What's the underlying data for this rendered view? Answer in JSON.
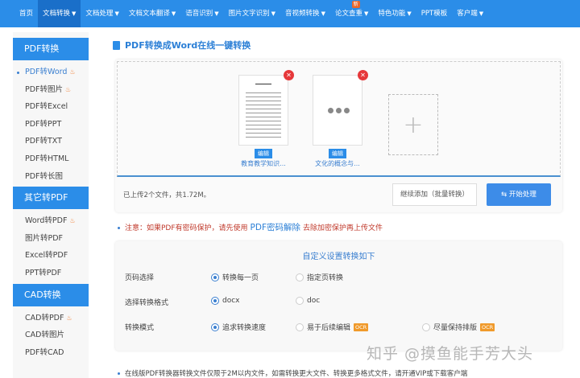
{
  "nav": [
    {
      "label": "首页",
      "caret": false
    },
    {
      "label": "文档转换",
      "caret": true,
      "active": true
    },
    {
      "label": "文档处理",
      "caret": true
    },
    {
      "label": "文档文本翻译",
      "caret": true
    },
    {
      "label": "语音识别",
      "caret": true
    },
    {
      "label": "图片文字识别",
      "caret": true
    },
    {
      "label": "音视频转换",
      "caret": true
    },
    {
      "label": "论文查重",
      "caret": true,
      "badge": "新"
    },
    {
      "label": "特色功能",
      "caret": true
    },
    {
      "label": "PPT模板",
      "caret": false
    },
    {
      "label": "客户端",
      "caret": true
    }
  ],
  "sidebar": [
    {
      "header": "PDF转换",
      "items": [
        {
          "label": "PDF转Word",
          "hot": true,
          "active": true
        },
        {
          "label": "PDF转图片",
          "hot": true
        },
        {
          "label": "PDF转Excel"
        },
        {
          "label": "PDF转PPT"
        },
        {
          "label": "PDF转TXT"
        },
        {
          "label": "PDF转HTML"
        },
        {
          "label": "PDF转长图"
        }
      ]
    },
    {
      "header": "其它转PDF",
      "items": [
        {
          "label": "Word转PDF",
          "hot": true
        },
        {
          "label": "图片转PDF"
        },
        {
          "label": "Excel转PDF"
        },
        {
          "label": "PPT转PDF"
        }
      ]
    },
    {
      "header": "CAD转换",
      "items": [
        {
          "label": "CAD转PDF",
          "hot": true
        },
        {
          "label": "CAD转图片"
        },
        {
          "label": "PDF转CAD"
        }
      ]
    }
  ],
  "title": "PDF转换成Word在线一键转换",
  "files": [
    {
      "name": "教育教学知识...",
      "edit": "编辑",
      "loading": false
    },
    {
      "name": "文化的概念与...",
      "edit": "编辑",
      "loading": true
    }
  ],
  "upload": {
    "info": "已上传2个文件，共1.72M。",
    "add_more": "继续添加（批量转换）",
    "start": "开始处理",
    "start_icon": "swap-icon"
  },
  "note": {
    "prefix": "注意：如果PDF有密码保护，请先使用",
    "link": "PDF密码解除",
    "suffix": "去除加密保护再上传文件"
  },
  "settings": {
    "title": "自定义设置转换如下",
    "rows": [
      {
        "label": "页码选择",
        "options": [
          {
            "label": "转换每一页",
            "checked": true
          },
          {
            "label": "指定页转换"
          }
        ]
      },
      {
        "label": "选择转换格式",
        "options": [
          {
            "label": "docx",
            "checked": true
          },
          {
            "label": "doc"
          }
        ]
      },
      {
        "label": "转换模式",
        "options": [
          {
            "label": "追求转换速度",
            "checked": true
          },
          {
            "label": "易于后续编辑",
            "badge": "OCR"
          },
          {
            "label": "尽量保持排版",
            "badge": "OCR"
          }
        ]
      }
    ]
  },
  "bottom_note": "在线版PDF转换器转换文件仅限于2M以内文件，如需转换更大文件、转换更多格式文件，请开通VIP或下载客户端",
  "watermark": "知乎 @摸鱼能手芳大头"
}
